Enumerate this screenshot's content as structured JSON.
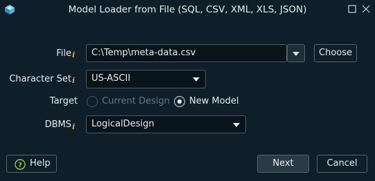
{
  "window": {
    "title": "Model Loader from File (SQL, CSV, XML, XLS, JSON)"
  },
  "form": {
    "file": {
      "label": "File",
      "value": "C:\\Temp\\meta-data.csv",
      "choose_label": "Choose"
    },
    "charset": {
      "label": "Character Set",
      "value": "US-ASCII"
    },
    "target": {
      "label": "Target",
      "options": [
        {
          "label": "Current Design",
          "selected": false,
          "enabled": false
        },
        {
          "label": "New Model",
          "selected": true,
          "enabled": true
        }
      ]
    },
    "dbms": {
      "label": "DBMS",
      "value": "LogicalDesign"
    },
    "info_marker": "i"
  },
  "footer": {
    "help_label": "Help",
    "next_label": "Next",
    "cancel_label": "Cancel"
  },
  "colors": {
    "background": "#0f1e28",
    "info_accent": "#e8a31f"
  }
}
